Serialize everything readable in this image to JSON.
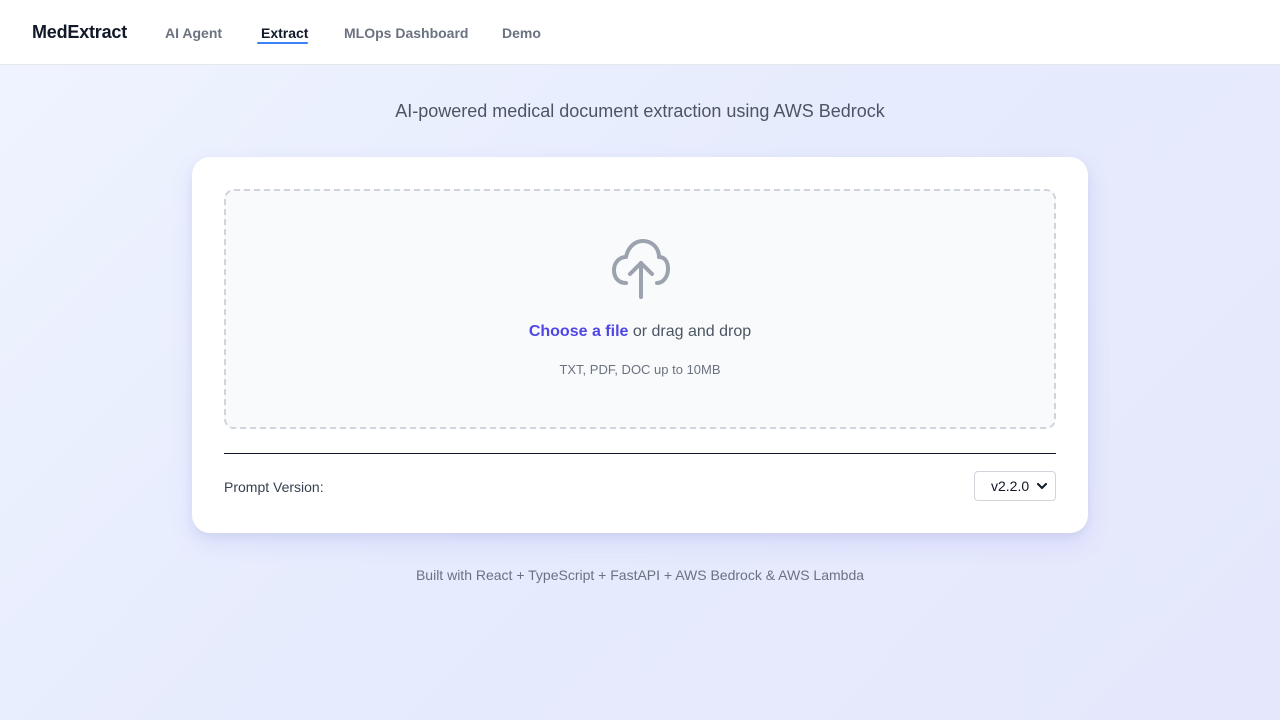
{
  "nav": {
    "brand": "MedExtract",
    "links": [
      {
        "label": "AI Agent",
        "active": false
      },
      {
        "label": "Extract",
        "active": true
      },
      {
        "label": "MLOps Dashboard",
        "active": false
      },
      {
        "label": "Demo",
        "active": false
      }
    ]
  },
  "hero": {
    "tagline": "AI-powered medical document extraction using AWS Bedrock"
  },
  "upload": {
    "icon": "cloud-upload-icon",
    "choose_label": "Choose a file",
    "drag_text": " or drag and drop",
    "hint": "TXT, PDF, DOC up to 10MB"
  },
  "prompt_version": {
    "label": "Prompt Version:",
    "selected": "v2.2.0"
  },
  "footer": {
    "text": "Built with React + TypeScript + FastAPI + AWS Bedrock & AWS Lambda"
  },
  "colors": {
    "accent": "#4f46e5",
    "nav_underline": "#3b82f6"
  }
}
